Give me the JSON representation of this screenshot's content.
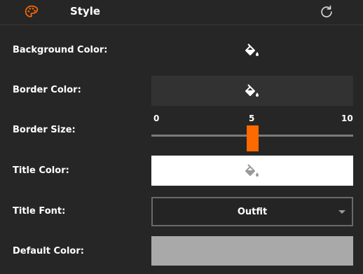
{
  "header": {
    "title": "Style",
    "icons": {
      "left": "palette-icon",
      "right": "reset-icon"
    },
    "accent": "#ff6a00"
  },
  "rows": {
    "background_color": {
      "label": "Background Color:",
      "icon": "paint-bucket-icon",
      "color": "#262626"
    },
    "border_color": {
      "label": "Border Color:",
      "icon": "paint-bucket-icon",
      "color": "#323232"
    },
    "border_size": {
      "label": "Border Size:",
      "min": "0",
      "max": "10",
      "value": "5"
    },
    "title_color": {
      "label": "Title Color:",
      "icon": "paint-bucket-icon",
      "color": "#ffffff"
    },
    "title_font": {
      "label": "Title Font:",
      "value": "Outfit"
    },
    "default_color": {
      "label": "Default Color:",
      "color": "#a9a9a9"
    }
  }
}
